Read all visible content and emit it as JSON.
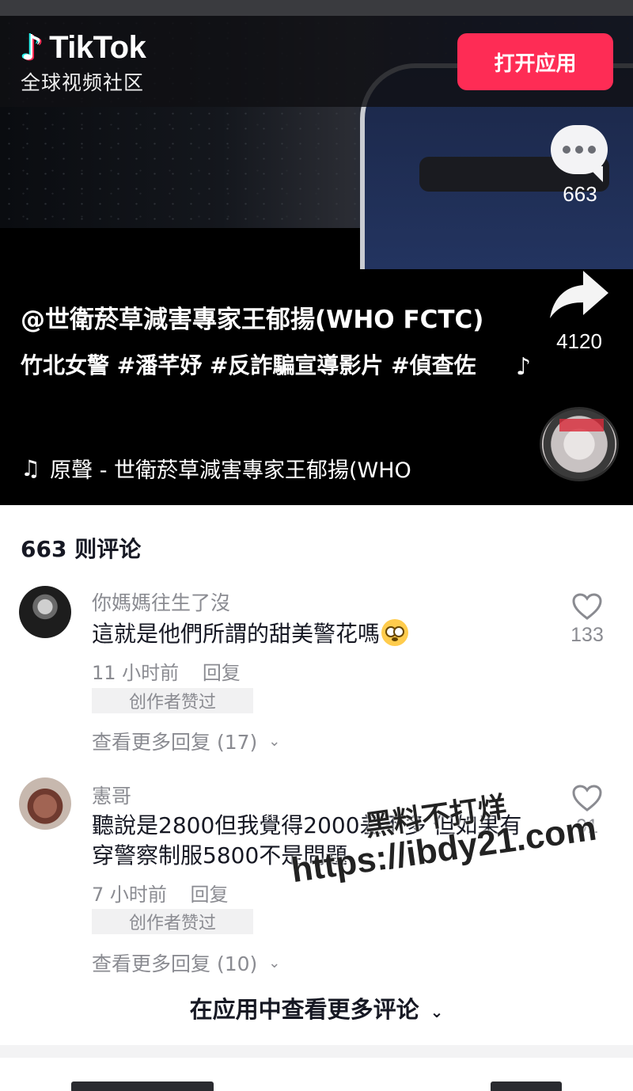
{
  "header": {
    "brand": "TikTok",
    "subtitle": "全球视频社区",
    "open_app_button": "打开应用"
  },
  "video": {
    "comment_count": "663",
    "share_count": "4120",
    "author": "@世衛菸草減害專家王郁揚(WHO FCTC)",
    "tags": "竹北女警 #潘芊妤 #反詐騙宣導影片 #偵查佐",
    "music": "原聲 - 世衛菸草減害專家王郁揚(WHO",
    "icons": [
      "tiktok-logo-icon",
      "comment-bubble-icon",
      "share-arrow-icon",
      "music-note-icon",
      "music-disc-icon"
    ]
  },
  "comments": {
    "title": "663 则评论",
    "items": [
      {
        "user": "你媽媽往生了沒",
        "text": "這就是他們所謂的甜美警花嗎",
        "emoji": "flushed-face",
        "time": "11 小时前",
        "reply": "回复",
        "badge": "创作者赞过",
        "more_replies": "查看更多回复 (17)",
        "likes": "133"
      },
      {
        "user": "憲哥",
        "text": "聽說是2800但我覺得2000差不多 但如果有穿警察制服5800不是問題",
        "time": "7 小时前",
        "reply": "回复",
        "badge": "创作者赞过",
        "more_replies": "查看更多回复 (10)",
        "likes": "91"
      }
    ],
    "view_more": "在应用中查看更多评论"
  },
  "watermark": {
    "line1": "黑料不打烊",
    "line2": "https://ibdy21.com"
  },
  "colors": {
    "accent": "#fe2c55",
    "secondary_text": "#8a8b91",
    "primary_text": "#161823"
  }
}
